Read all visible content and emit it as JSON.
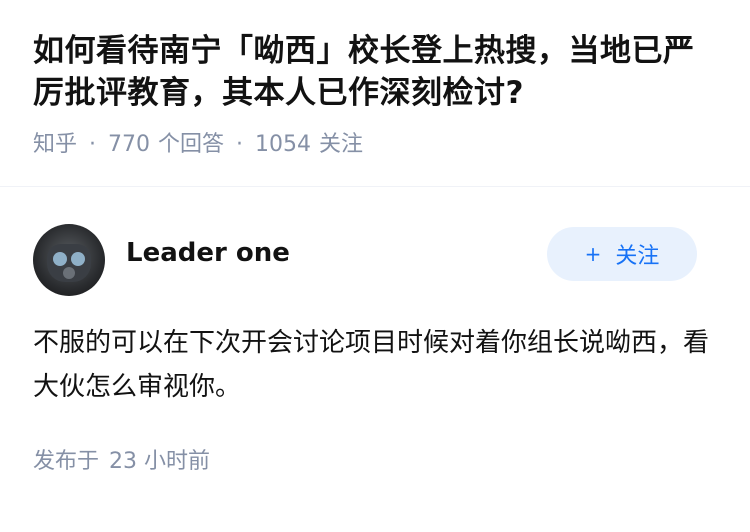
{
  "question": {
    "title": "如何看待南宁「呦西」校长登上热搜，当地已严厉批评教育，其本人已作深刻检讨?",
    "source": "知乎",
    "separator": "·",
    "answer_count": "770",
    "answer_label": "个回答",
    "follower_count": "1054",
    "follower_label": "关注"
  },
  "answer": {
    "author_name": "Leader one",
    "follow_button": {
      "icon": "+",
      "label": "关注"
    },
    "content": "不服的可以在下次开会讨论项目时候对着你组长说呦西，看大伙怎么审视你。",
    "published_label": "发布于",
    "published_time": "23 小时前"
  },
  "colors": {
    "text": "#121212",
    "meta": "#8590a6",
    "accent": "#1772f6",
    "button_bg": "#e8f1fd"
  }
}
